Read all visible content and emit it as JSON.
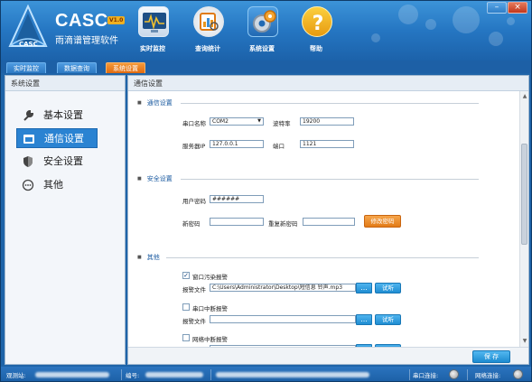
{
  "window": {
    "minimize_label": "–",
    "close_label": "×"
  },
  "app": {
    "name": "CASC",
    "version": "V1.0",
    "subtitle": "雨滴谱管理软件",
    "logo_text": "CASC"
  },
  "toolbar": {
    "items": [
      {
        "label": "实时监控",
        "icon": "monitor-icon"
      },
      {
        "label": "查询统计",
        "icon": "chart-icon"
      },
      {
        "label": "系统设置",
        "icon": "gear-icon"
      },
      {
        "label": "帮助",
        "icon": "help-icon"
      }
    ]
  },
  "tabs": [
    {
      "label": "实时监控",
      "active": false
    },
    {
      "label": "数据查询",
      "active": false
    },
    {
      "label": "系统设置",
      "active": true
    }
  ],
  "sidebar": {
    "title": "系统设置",
    "items": [
      {
        "label": "基本设置",
        "icon": "wrench-icon",
        "active": false
      },
      {
        "label": "通信设置",
        "icon": "comm-icon",
        "active": true
      },
      {
        "label": "安全设置",
        "icon": "shield-icon",
        "active": false
      },
      {
        "label": "其他",
        "icon": "more-icon",
        "active": false
      }
    ]
  },
  "main": {
    "title": "通信设置",
    "comm": {
      "section_title": "通信设置",
      "port_label": "串口名称",
      "port_value": "COM2",
      "baud_label": "波特率",
      "baud_value": "19200",
      "server_ip_label": "服务器IP",
      "server_ip_value": "127.0.0.1",
      "port_num_label": "端口",
      "port_num_value": "1121"
    },
    "security": {
      "section_title": "安全设置",
      "user_pwd_label": "用户密码",
      "user_pwd_value": "######",
      "new_pwd_label": "新密码",
      "new_pwd_value": "",
      "confirm_pwd_label": "重复新密码",
      "confirm_pwd_value": "",
      "change_pwd_button": "修改密码"
    },
    "other": {
      "section_title": "其他",
      "alarms": [
        {
          "checkbox_label": "窗口污染报警",
          "checked": true,
          "file_label": "报警文件",
          "file_value": "C:\\Users\\Administrator\\Desktop\\短信息 铃声.mp3",
          "browse": "...",
          "test": "试听"
        },
        {
          "checkbox_label": "串口中断报警",
          "checked": false,
          "file_label": "报警文件",
          "file_value": "",
          "browse": "...",
          "test": "试听"
        },
        {
          "checkbox_label": "网络中断报警",
          "checked": false,
          "file_label": "",
          "file_value": "",
          "browse": "",
          "test": ""
        }
      ]
    },
    "save_button": "保 存"
  },
  "statusbar": {
    "site_label": "观测站:",
    "id_label": "编号:",
    "serial_label": "串口连接:",
    "network_label": "网络连接:"
  }
}
